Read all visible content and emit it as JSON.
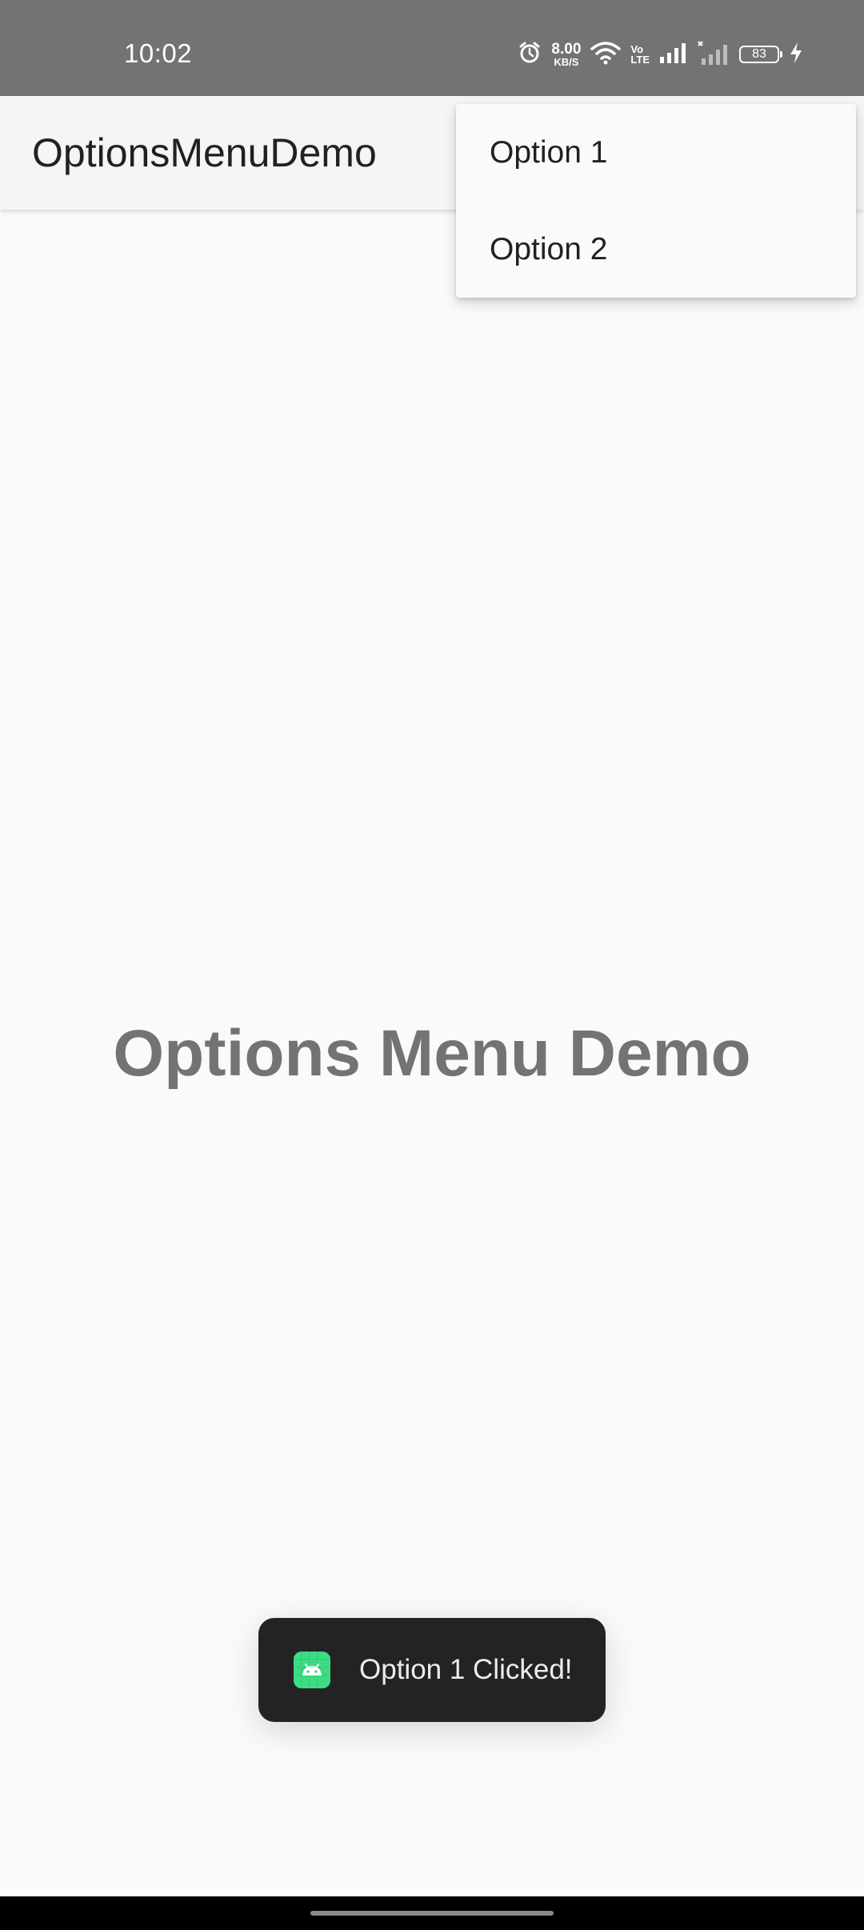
{
  "status_bar": {
    "time": "10:02",
    "net_speed_value": "8.00",
    "net_speed_unit": "KB/S",
    "volte_top": "Vo",
    "volte_bottom": "LTE",
    "battery": "83",
    "icons": [
      "alarm-icon",
      "wifi-icon",
      "signal-icon",
      "signal-no-service-icon",
      "battery-icon",
      "charging-icon"
    ]
  },
  "app_bar": {
    "title": "OptionsMenuDemo"
  },
  "menu": {
    "items": [
      {
        "label": "Option 1"
      },
      {
        "label": "Option 2"
      }
    ]
  },
  "main": {
    "heading": "Options Menu Demo"
  },
  "toast": {
    "message": "Option 1 Clicked!",
    "icon": "android-app-icon"
  },
  "colors": {
    "status_bar": "#737373",
    "app_bar": "#f5f5f5",
    "background": "#fafafa",
    "heading": "#737373",
    "toast_bg": "#232323",
    "android_green": "#3ddc84"
  }
}
